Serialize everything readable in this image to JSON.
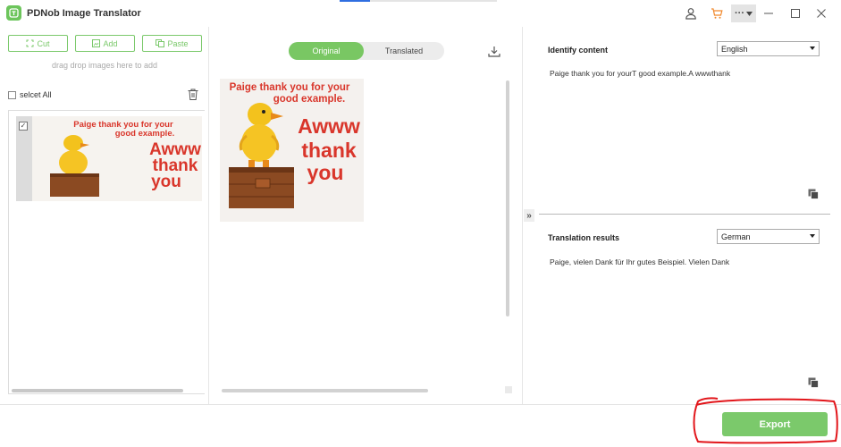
{
  "window": {
    "title": "PDNob Image Translator",
    "more_label": "···"
  },
  "left": {
    "cut_label": "Cut",
    "add_label": "Add",
    "paste_label": "Paste",
    "drag_hint": "drag drop images here to add",
    "select_all_label": "selcet All"
  },
  "image_text": {
    "line1": "Paige thank you for your",
    "line2": "good example.",
    "word1": "Awww",
    "word2": "thank",
    "word3": "you"
  },
  "middle": {
    "original_tab": "Original",
    "translated_tab": "Translated"
  },
  "identify": {
    "title": "Identify content",
    "language": "English",
    "text": "Paige thank you for yourT good example.A wwwthank"
  },
  "results": {
    "title": "Translation results",
    "language": "German",
    "text": "Paige, vielen Dank für Ihr gutes Beispiel. Vielen Dank"
  },
  "export_label": "Export",
  "colors": {
    "accent_green": "#7bc96b",
    "annotation_red": "#e2161b",
    "image_text_red": "#d9362b"
  }
}
